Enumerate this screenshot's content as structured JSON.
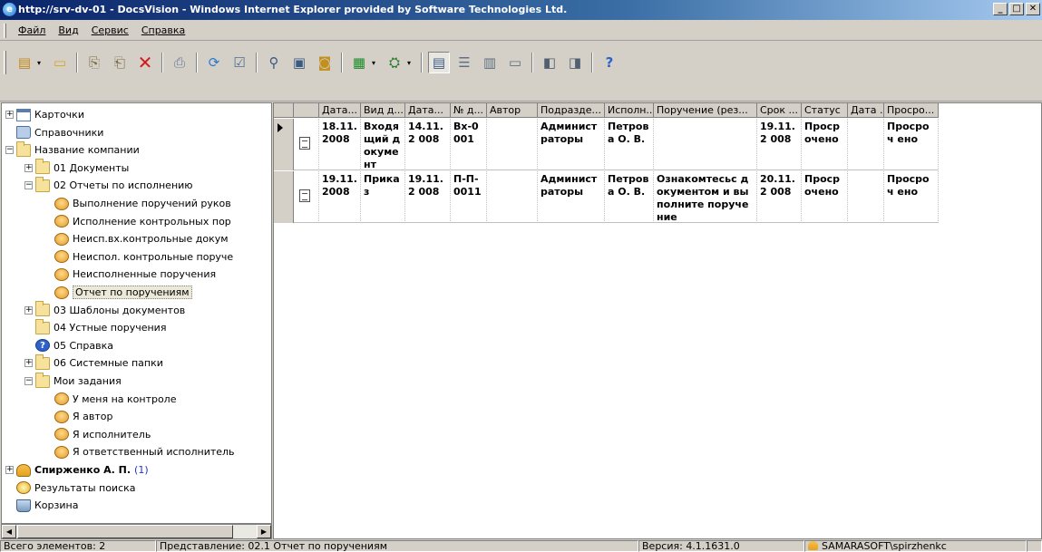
{
  "window": {
    "title": "http://srv-dv-01 - DocsVision - Windows Internet Explorer provided by Software Technologies Ltd.",
    "minimize_label": "_",
    "maximize_label": "□",
    "close_label": "✕"
  },
  "menu": [
    "Файл",
    "Вид",
    "Сервис",
    "Справка"
  ],
  "tree": [
    {
      "label": "Карточки",
      "icon": "card-icon",
      "exp": "+",
      "level": 0
    },
    {
      "label": "Справочники",
      "icon": "book-icon",
      "exp": "",
      "level": 0
    },
    {
      "label": "Название компании",
      "icon": "folder-icon",
      "exp": "−",
      "level": 0
    },
    {
      "label": "01 Документы",
      "icon": "folder-icon",
      "exp": "+",
      "level": 1
    },
    {
      "label": "02 Отчеты по исполнению",
      "icon": "folder-icon",
      "exp": "−",
      "level": 1
    },
    {
      "label": "Выполнение поручений руков",
      "icon": "report-icon",
      "exp": "",
      "level": 2
    },
    {
      "label": "Исполнение контрольных пор",
      "icon": "report-icon",
      "exp": "",
      "level": 2
    },
    {
      "label": "Неисп.вх.контрольные докум",
      "icon": "report-icon",
      "exp": "",
      "level": 2
    },
    {
      "label": "Неиспол. контрольные поруче",
      "icon": "report-icon",
      "exp": "",
      "level": 2
    },
    {
      "label": "Неисполненные поручения",
      "icon": "report-icon",
      "exp": "",
      "level": 2
    },
    {
      "label": "Отчет по поручениям",
      "icon": "report-icon",
      "exp": "",
      "level": 2,
      "selected": true
    },
    {
      "label": "03 Шаблоны документов",
      "icon": "folder-icon",
      "exp": "+",
      "level": 1
    },
    {
      "label": "04 Устные поручения",
      "icon": "folder-icon",
      "exp": "",
      "level": 1
    },
    {
      "label": "05 Справка",
      "icon": "help-icon",
      "exp": "",
      "level": 1
    },
    {
      "label": "06 Системные папки",
      "icon": "folder-icon",
      "exp": "+",
      "level": 1
    },
    {
      "label": "Мои задания",
      "icon": "folder-icon",
      "exp": "−",
      "level": 1
    },
    {
      "label": "У меня на контроле",
      "icon": "report-icon",
      "exp": "",
      "level": 2
    },
    {
      "label": "Я автор",
      "icon": "report-icon",
      "exp": "",
      "level": 2
    },
    {
      "label": "Я исполнитель",
      "icon": "report-icon",
      "exp": "",
      "level": 2
    },
    {
      "label": "Я ответственный исполнитель",
      "icon": "report-icon",
      "exp": "",
      "level": 2
    },
    {
      "label": "Спирженко А. П.",
      "icon": "user-icon",
      "exp": "+",
      "level": 0,
      "bold": true,
      "count": "(1)"
    },
    {
      "label": "Результаты поиска",
      "icon": "search-icon",
      "exp": "",
      "level": 0
    },
    {
      "label": "Корзина",
      "icon": "trash-icon",
      "exp": "",
      "level": 0
    }
  ],
  "grid": {
    "columns": [
      "",
      "",
      "Дата...",
      "Вид д...",
      "Дата...",
      "№ д...",
      "Автор",
      "Подразде...",
      "Исполн...",
      "Поручение (рез...",
      "Срок ...",
      "Статус",
      "Дата ...",
      "Просро..."
    ],
    "rows": [
      [
        "",
        "",
        "18.11. 2008",
        "Входя щий докуме нт",
        "14.11.2 008",
        "Вх-0 001",
        "",
        "Админист раторы",
        "Петрова О. В.",
        "",
        "19.11.2 008",
        "Проср очено",
        "",
        "Просроч ено"
      ],
      [
        "",
        "",
        "19.11. 2008",
        "Приказ",
        "19.11.2 008",
        "П-П- 0011",
        "",
        "Админист раторы",
        "Петрова О. В.",
        "Ознакомтесьс документом и выполните поручение",
        "20.11.2 008",
        "Проср очено",
        "",
        "Просроч ено"
      ]
    ]
  },
  "status": {
    "count": "Всего элементов: 2",
    "view": "Представление: 02.1 Отчет по поручениям",
    "version": "Версия: 4.1.1631.0",
    "user": "SAMARASOFT\\spirzhenkc"
  }
}
